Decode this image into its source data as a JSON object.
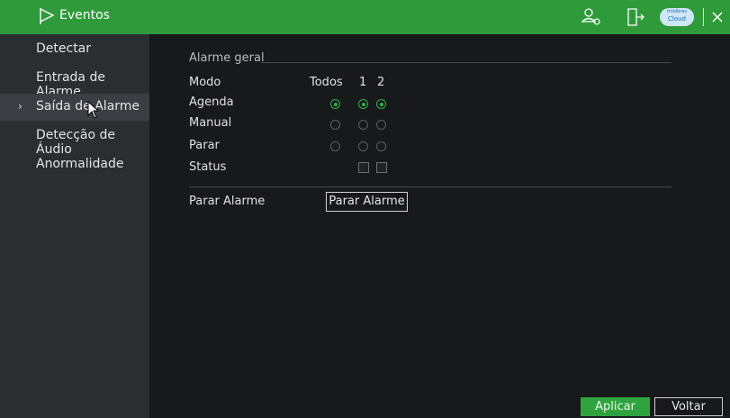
{
  "header": {
    "title": "Eventos"
  },
  "cloud": {
    "line1": "intelbras",
    "line2": "Cloud"
  },
  "sidebar": {
    "items": [
      {
        "label": "Detectar"
      },
      {
        "label": "Entrada de Alarme"
      },
      {
        "label": "Saída de Alarme",
        "active": true
      },
      {
        "label": "Detecção de Áudio"
      },
      {
        "label": "Anormalidade"
      }
    ]
  },
  "main": {
    "group_title": "Alarme geral",
    "mode_label": "Modo",
    "col_all": "Todos",
    "col_1": "1",
    "col_2": "2",
    "rows": [
      {
        "label": "Agenda",
        "todos": true,
        "c1": true,
        "c2": true
      },
      {
        "label": "Manual",
        "todos": false,
        "c1": false,
        "c2": false
      },
      {
        "label": "Parar",
        "todos": false,
        "c1": false,
        "c2": false
      }
    ],
    "status_label": "Status",
    "stop_label": "Parar Alarme",
    "stop_button": "Parar Alarme"
  },
  "footer": {
    "apply": "Aplicar",
    "back": "Voltar"
  }
}
